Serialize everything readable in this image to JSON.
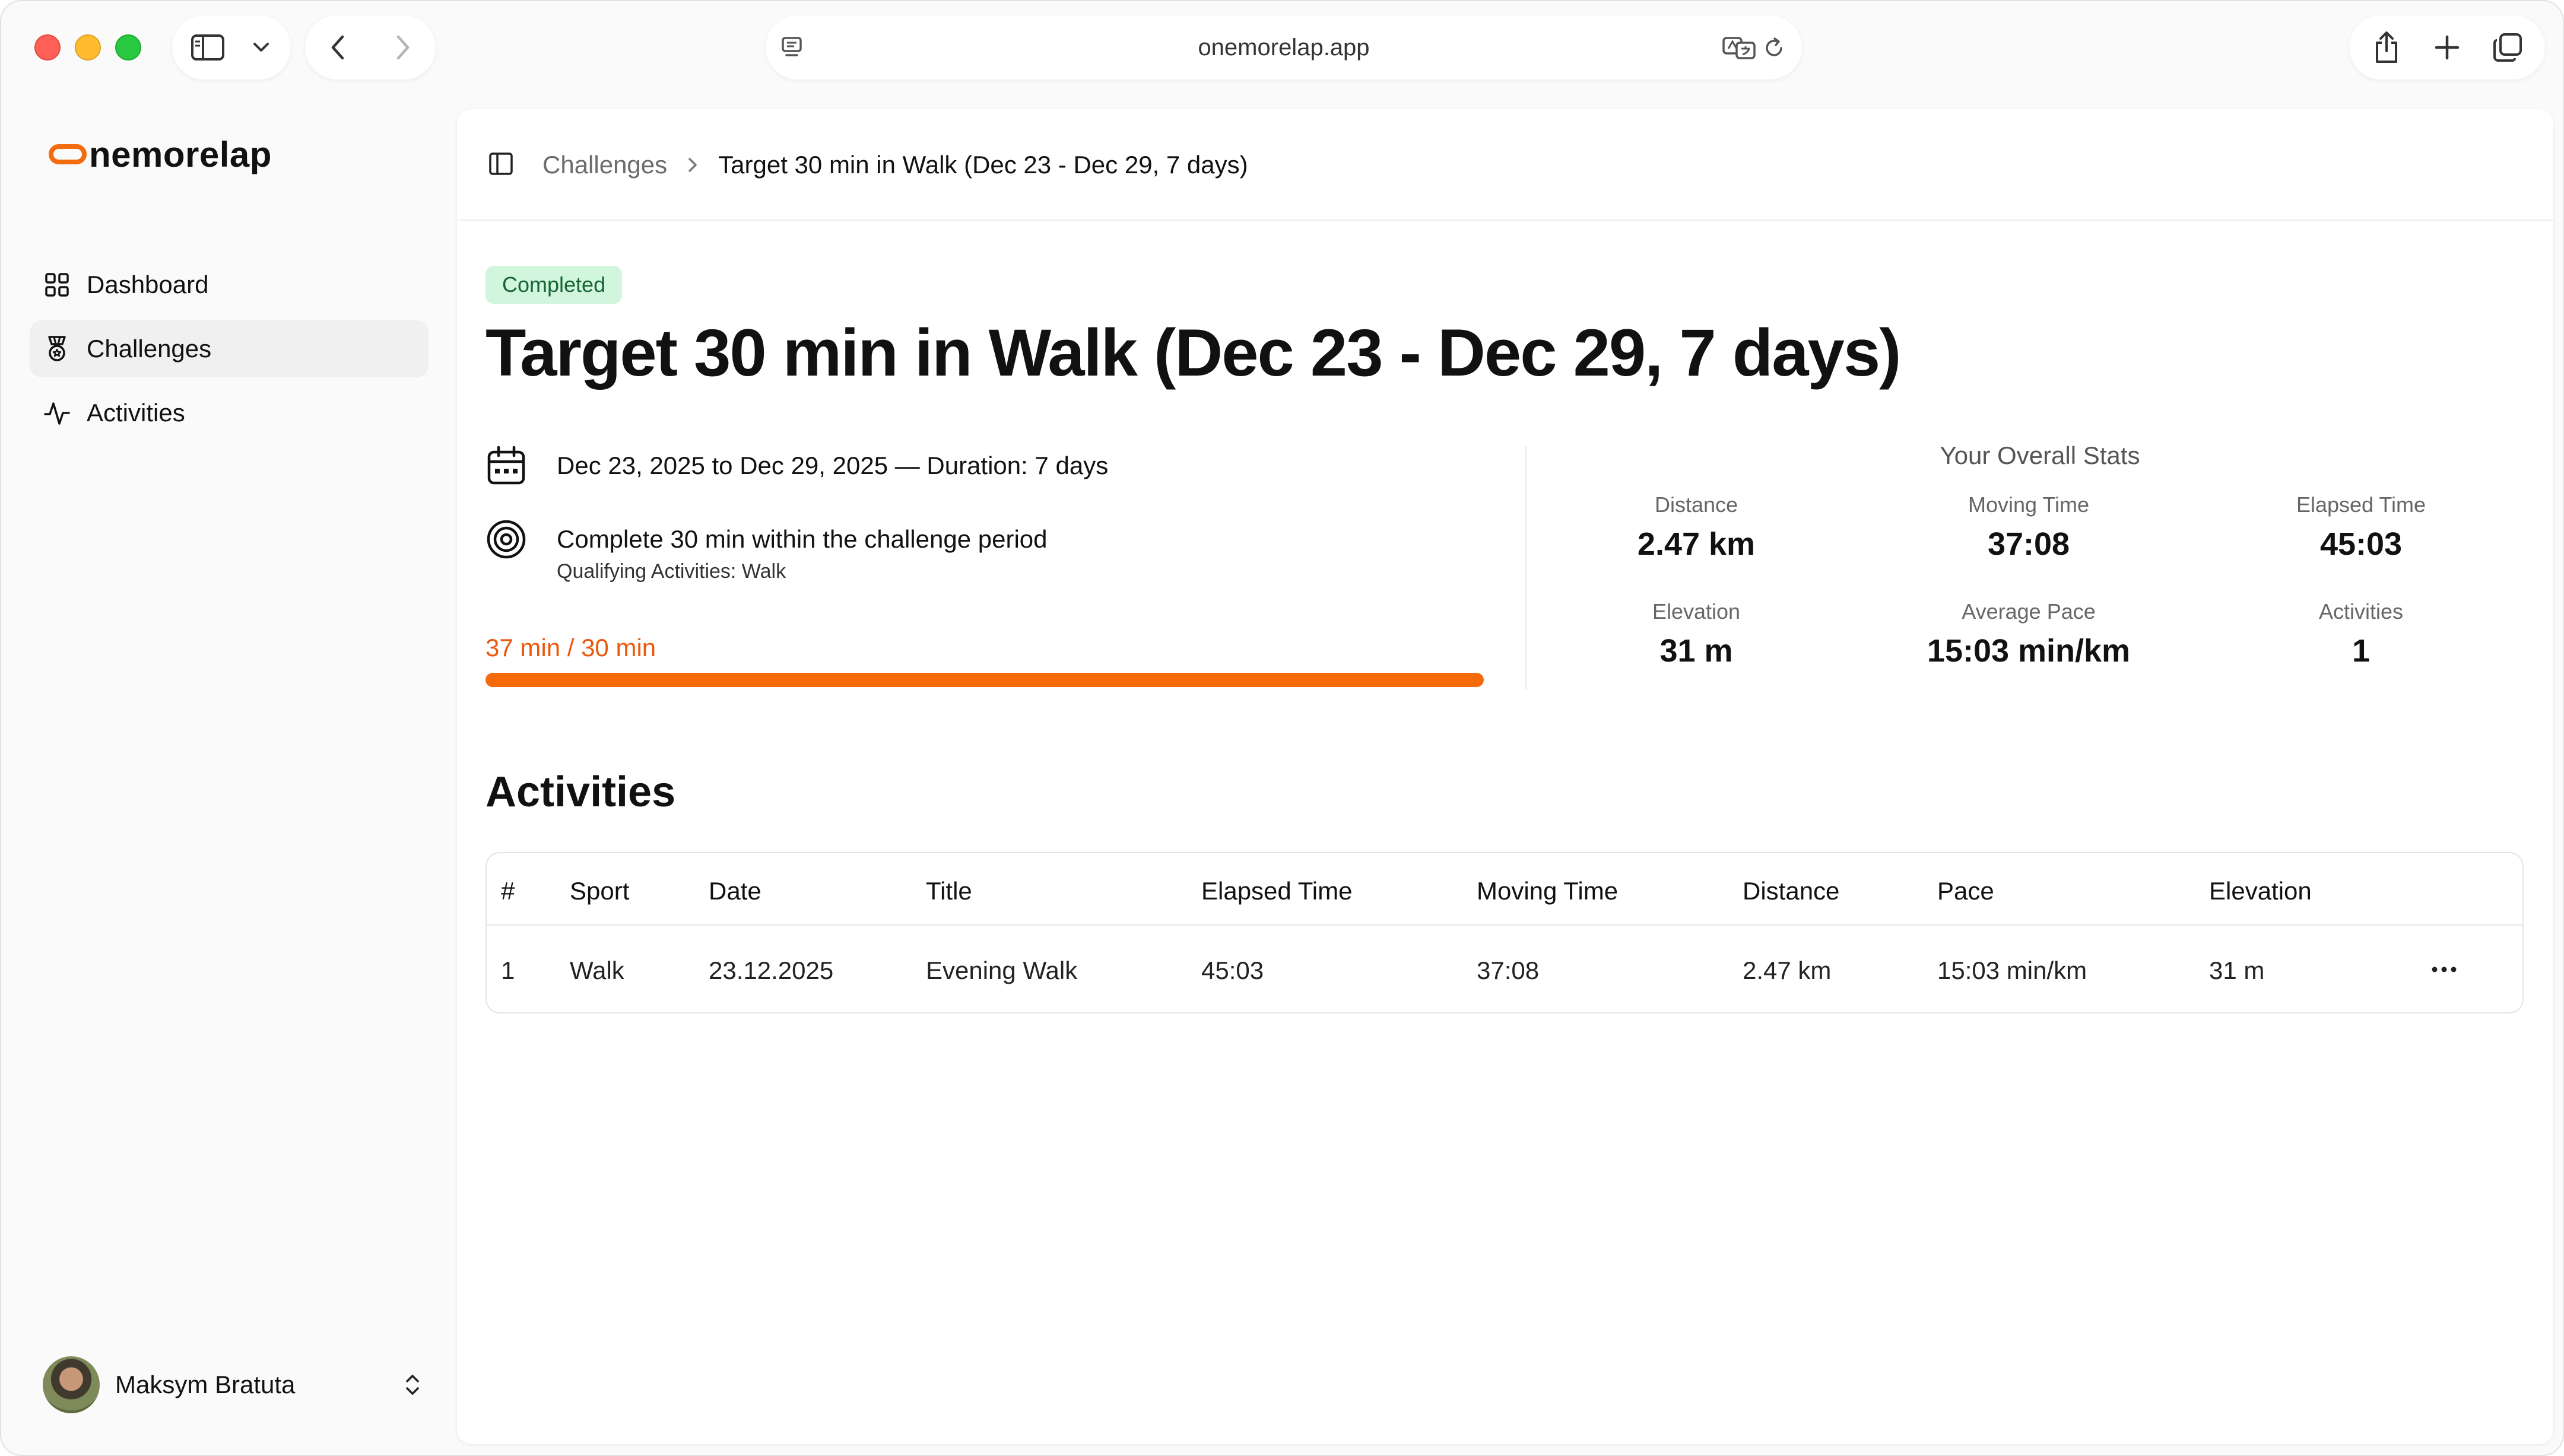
{
  "browser": {
    "url": "onemorelap.app"
  },
  "sidebar": {
    "logo_text": "nemorelap",
    "items": [
      {
        "label": "Dashboard",
        "icon": "grid-icon",
        "active": false
      },
      {
        "label": "Challenges",
        "icon": "award-icon",
        "active": true
      },
      {
        "label": "Activities",
        "icon": "activity-icon",
        "active": false
      }
    ],
    "user": {
      "name": "Maksym Bratuta"
    }
  },
  "breadcrumb": {
    "parent": "Challenges",
    "current": "Target 30 min in Walk (Dec 23 - Dec 29, 7 days)"
  },
  "challenge": {
    "status": "Completed",
    "title": "Target 30 min in Walk (Dec 23 - Dec 29, 7 days)",
    "date_range": "Dec 23, 2025 to Dec 29, 2025 — Duration: 7 days",
    "goal": "Complete 30 min within the challenge period",
    "qualifying": "Qualifying Activities: Walk",
    "progress_label": "37 min / 30 min",
    "progress_fraction": 1.0
  },
  "stats": {
    "title": "Your Overall Stats",
    "items": [
      {
        "label": "Distance",
        "value": "2.47 km"
      },
      {
        "label": "Moving Time",
        "value": "37:08"
      },
      {
        "label": "Elapsed Time",
        "value": "45:03"
      },
      {
        "label": "Elevation",
        "value": "31 m"
      },
      {
        "label": "Average Pace",
        "value": "15:03 min/km"
      },
      {
        "label": "Activities",
        "value": "1"
      }
    ]
  },
  "activities": {
    "title": "Activities",
    "columns": [
      "#",
      "Sport",
      "Date",
      "Title",
      "Elapsed Time",
      "Moving Time",
      "Distance",
      "Pace",
      "Elevation"
    ],
    "rows": [
      [
        "1",
        "Walk",
        "23.12.2025",
        "Evening Walk",
        "45:03",
        "37:08",
        "2.47 km",
        "15:03 min/km",
        "31 m"
      ]
    ]
  },
  "colors": {
    "accent": "#f56a0a",
    "badge_bg": "#d2f5de",
    "badge_text": "#166534"
  }
}
